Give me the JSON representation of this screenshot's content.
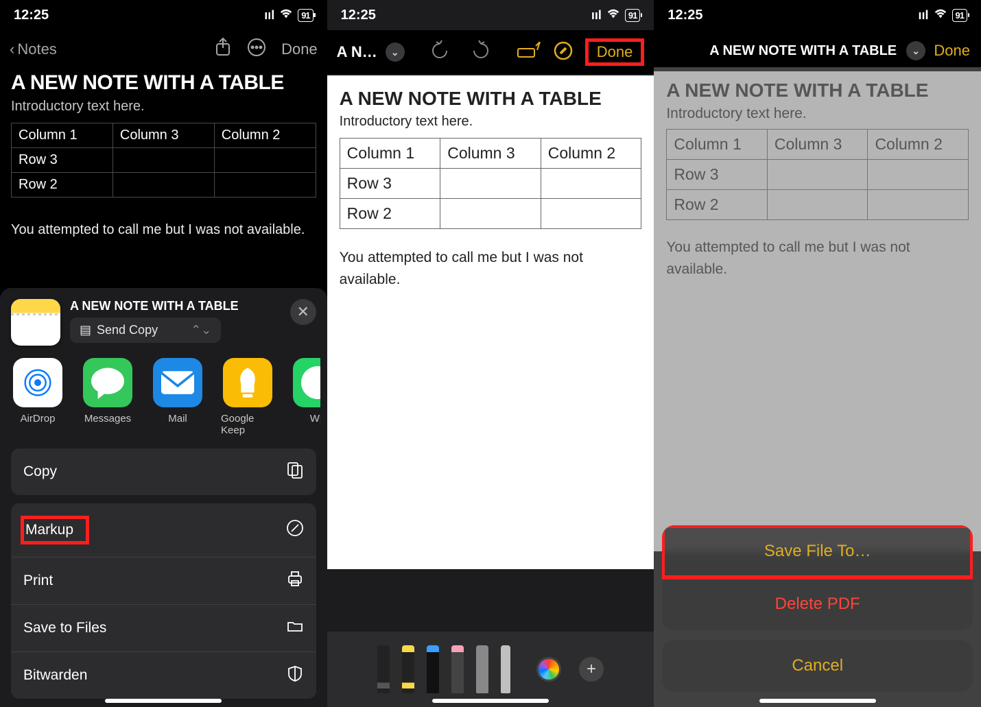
{
  "status": {
    "time": "12:25",
    "battery": "91"
  },
  "screen1": {
    "back": "Notes",
    "done": "Done",
    "title": "A NEW NOTE WITH A TABLE",
    "intro": "Introductory text here.",
    "table": {
      "headers": [
        "Column 1",
        "Column 3",
        "Column 2"
      ],
      "rows": [
        [
          "Row 3",
          "",
          ""
        ],
        [
          "Row 2",
          "",
          ""
        ]
      ]
    },
    "body": "You attempted to call me but I was not available.",
    "share": {
      "title": "A NEW NOTE WITH A TABLE",
      "sendCopy": "Send Copy",
      "apps": {
        "airdrop": "AirDrop",
        "messages": "Messages",
        "mail": "Mail",
        "keep": "Google Keep",
        "whatsapp": "Wh"
      },
      "actions": {
        "copy": "Copy",
        "markup": "Markup",
        "print": "Print",
        "savefiles": "Save to Files",
        "bitwarden": "Bitwarden"
      }
    }
  },
  "screen2": {
    "titleShort": "A N…",
    "done": "Done",
    "title": "A NEW NOTE WITH A TABLE",
    "intro": "Introductory text here.",
    "table": {
      "headers": [
        "Column 1",
        "Column 3",
        "Column 2"
      ],
      "rows": [
        [
          "Row 3",
          "",
          ""
        ],
        [
          "Row 2",
          "",
          ""
        ]
      ]
    },
    "body": "You attempted to call me but I was not available."
  },
  "screen3": {
    "titleFull": "A NEW NOTE WITH A TABLE",
    "done": "Done",
    "title": "A NEW NOTE WITH A TABLE",
    "intro": "Introductory text here.",
    "table": {
      "headers": [
        "Column 1",
        "Column 3",
        "Column 2"
      ],
      "rows": [
        [
          "Row 3",
          "",
          ""
        ],
        [
          "Row 2",
          "",
          ""
        ]
      ]
    },
    "body": "You attempted to call me but I was not available.",
    "sheet": {
      "saveFile": "Save File To…",
      "deletePdf": "Delete PDF",
      "cancel": "Cancel"
    }
  }
}
